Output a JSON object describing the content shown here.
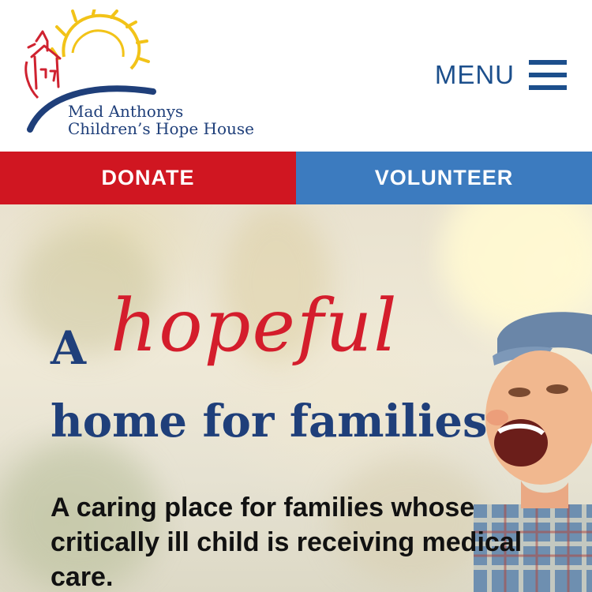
{
  "header": {
    "logo": {
      "line1": "Mad Anthonys",
      "line2": "Children’s Hope House"
    },
    "menu_label": "MENU"
  },
  "cta": {
    "donate_label": "DONATE",
    "volunteer_label": "VOLUNTEER"
  },
  "hero": {
    "headline_prefix": "A",
    "headline_script": "hopeful",
    "headline_rest": "home for families",
    "subtext": "A caring place for families whose critically ill child is receiving medical care."
  },
  "colors": {
    "brand_blue": "#1f3f7a",
    "menu_blue": "#1c4f8c",
    "donate_red": "#d01621",
    "volunteer_blue": "#3c7bbf",
    "script_red": "#d41d2c",
    "sun_yellow": "#f2c318"
  },
  "icons": {
    "menu": "hamburger-icon",
    "logo_mark": "sun-house-arc-logo"
  }
}
